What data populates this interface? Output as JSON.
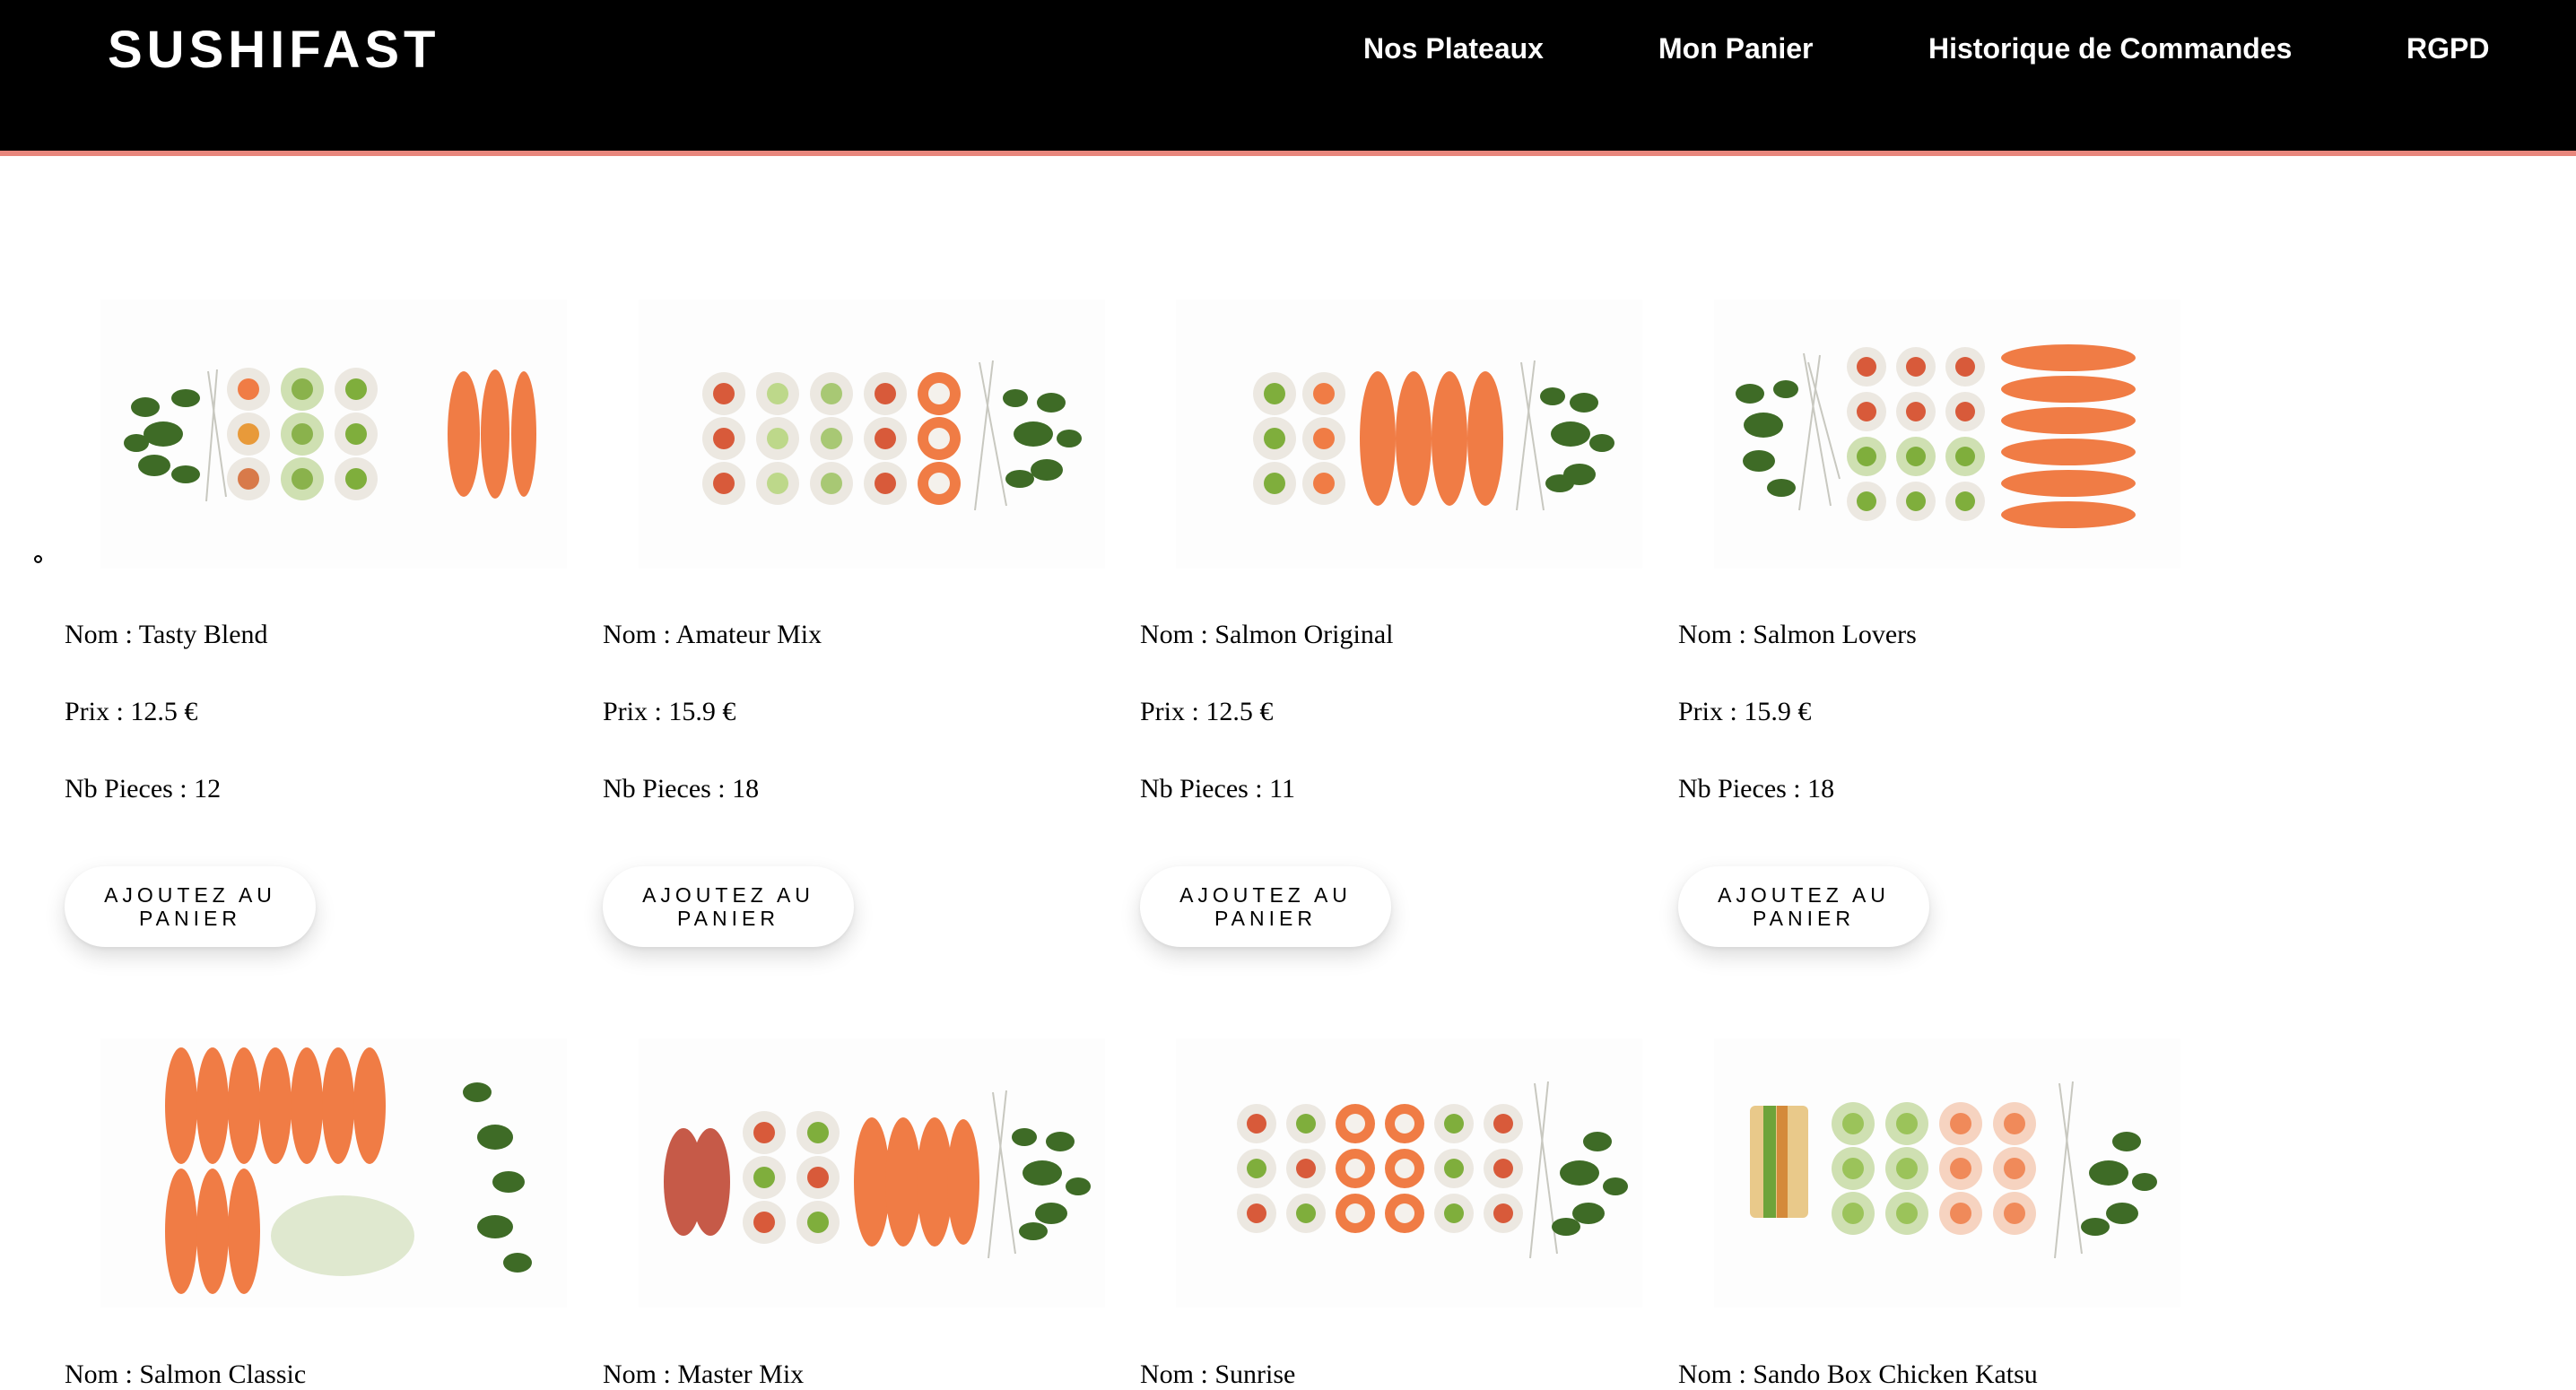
{
  "header": {
    "brand": "SUSHIFAST",
    "nav": [
      {
        "label": "Nos Plateaux"
      },
      {
        "label": "Mon Panier"
      },
      {
        "label": "Historique de Commandes"
      },
      {
        "label": "RGPD"
      }
    ]
  },
  "colors": {
    "header_background": "#000000",
    "header_border": "#e8867c",
    "salmon": "#f07c45",
    "edamame": "#3e6b26",
    "rice": "#ece8e1",
    "nori": "#2f3a2c"
  },
  "products": [
    {
      "name": "Nom : Tasty Blend",
      "price": "Prix : 12.5 €",
      "pieces": "Nb Pieces : 12",
      "button": "AJOUTEZ AU PANIER",
      "image_icon": "sushi-tray-image"
    },
    {
      "name": "Nom : Amateur Mix",
      "price": "Prix : 15.9 €",
      "pieces": "Nb Pieces : 18",
      "button": "AJOUTEZ AU PANIER",
      "image_icon": "sushi-tray-image"
    },
    {
      "name": "Nom : Salmon Original",
      "price": "Prix : 12.5 €",
      "pieces": "Nb Pieces : 11",
      "button": "AJOUTEZ AU PANIER",
      "image_icon": "sushi-tray-image"
    },
    {
      "name": "Nom : Salmon Lovers",
      "price": "Prix : 15.9 €",
      "pieces": "Nb Pieces : 18",
      "button": "AJOUTEZ AU PANIER",
      "image_icon": "sushi-tray-image"
    },
    {
      "name": "Nom : Salmon Classic",
      "image_icon": "sushi-tray-image"
    },
    {
      "name": "Nom : Master Mix",
      "image_icon": "sushi-tray-image"
    },
    {
      "name": "Nom : Sunrise",
      "image_icon": "sushi-tray-image"
    },
    {
      "name": "Nom : Sando Box Chicken Katsu",
      "image_icon": "sushi-tray-image"
    }
  ]
}
